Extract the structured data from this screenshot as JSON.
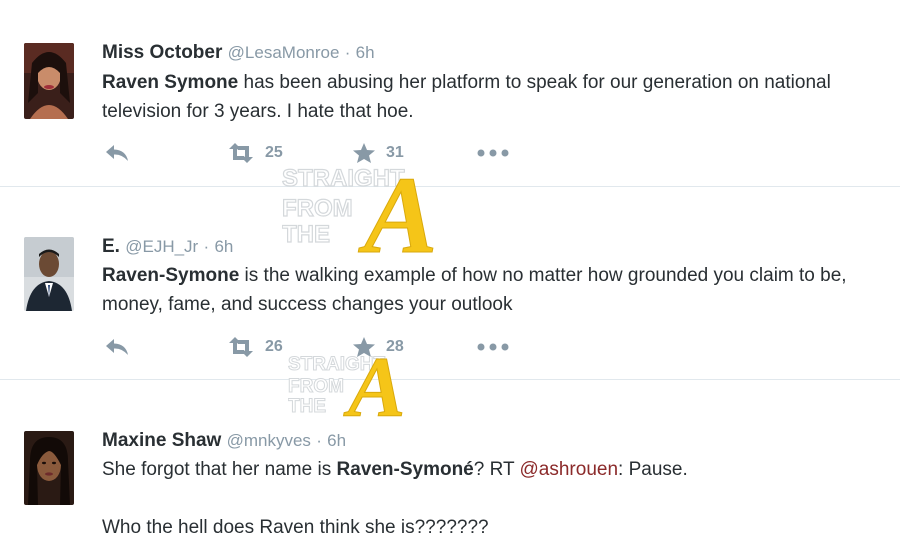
{
  "tweets": [
    {
      "name": "Miss October",
      "handle": "@LesaMonroe",
      "sep": "·",
      "time": "6h",
      "text_parts": [
        "Raven Symone",
        " has been abusing her platform to speak for our generation on national television for 3 years. I hate that hoe."
      ],
      "retweets": "25",
      "favorites": "31"
    },
    {
      "name": "E.",
      "handle": "@EJH_Jr",
      "sep": "·",
      "time": "6h",
      "text_parts": [
        "Raven-Symone",
        " is the walking example of how no matter how grounded you claim to be, money, fame, and success changes your outlook"
      ],
      "retweets": "26",
      "favorites": "28"
    },
    {
      "name": "Maxine Shaw",
      "handle": "@mnkyves",
      "sep": "·",
      "time": "6h",
      "text_parts": [
        "She forgot that her name is ",
        "Raven-Symoné",
        "? RT ",
        "@ashrouen",
        ": Pause.",
        "Who the hell does Raven think she is???????"
      ]
    }
  ],
  "icons": {
    "reply": "reply-icon",
    "retweet": "retweet-icon",
    "favorite": "star-icon",
    "more": "more-dots-icon"
  },
  "watermark": {
    "lines": [
      "STRAIGHT",
      "FROM",
      "THE",
      "A"
    ]
  },
  "colors": {
    "icon": "#8899a6",
    "text": "#292f33",
    "mention": "#8b2a2a",
    "divider": "#e1e8ed",
    "watermark_letter": "#f5c518"
  }
}
